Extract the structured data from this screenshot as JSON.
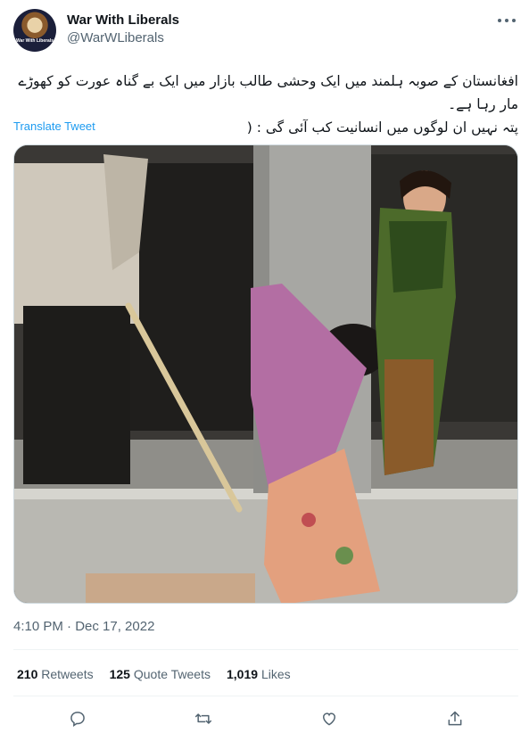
{
  "author": {
    "display_name": "War With Liberals",
    "handle": "@WarWLiberals",
    "avatar_caption": "War With Liberals"
  },
  "tweet": {
    "text_line1": "افغانستان کے صوبہ ہلمند میں ایک وحشی طالب بازار میں ایک بے گناہ عورت کو کھوڑے مار رہا ہے۔",
    "text_line2": "پتہ نہیں ان لوگوں میں انسانیت کب آئی گی : (",
    "translate_label": "Translate Tweet",
    "timestamp": "4:10 PM · Dec 17, 2022"
  },
  "stats": {
    "retweets_count": "210",
    "retweets_label": "Retweets",
    "quotes_count": "125",
    "quotes_label": "Quote Tweets",
    "likes_count": "1,019",
    "likes_label": "Likes"
  },
  "actions": {
    "reply_icon": "reply-icon",
    "retweet_icon": "retweet-icon",
    "like_icon": "heart-icon",
    "share_icon": "share-icon"
  },
  "colors": {
    "link": "#1d9bf0",
    "secondary_text": "#536471",
    "divider": "#eff3f4"
  }
}
